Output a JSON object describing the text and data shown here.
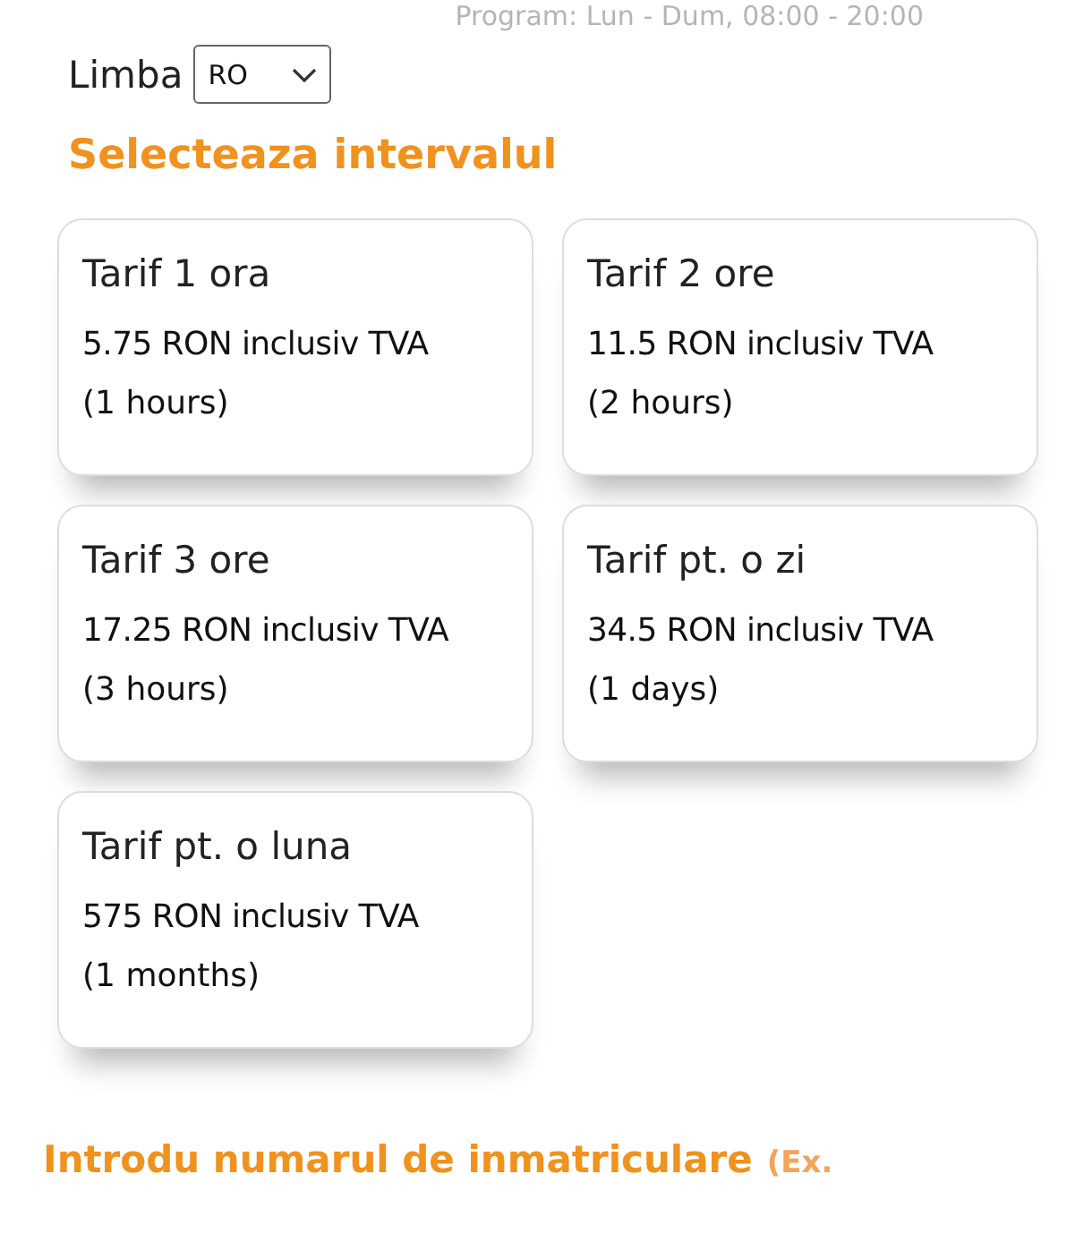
{
  "schedule": "Program: Lun - Dum, 08:00 - 20:00",
  "language": {
    "label": "Limba",
    "value": "RO"
  },
  "interval_heading": "Selecteaza intervalul",
  "tariffs": [
    {
      "title": "Tarif 1 ora",
      "price": "5.75 RON inclusiv TVA",
      "duration": "(1 hours)"
    },
    {
      "title": "Tarif 2 ore",
      "price": "11.5 RON inclusiv TVA",
      "duration": "(2 hours)"
    },
    {
      "title": "Tarif 3 ore",
      "price": "17.25 RON inclusiv TVA",
      "duration": "(3 hours)"
    },
    {
      "title": "Tarif pt. o zi",
      "price": "34.5 RON inclusiv TVA",
      "duration": "(1 days)"
    },
    {
      "title": "Tarif pt. o luna",
      "price": "575 RON inclusiv TVA",
      "duration": "(1 months)"
    }
  ],
  "plate_heading": {
    "text": "Introdu numarul de inmatriculare",
    "hint": "(Ex."
  }
}
